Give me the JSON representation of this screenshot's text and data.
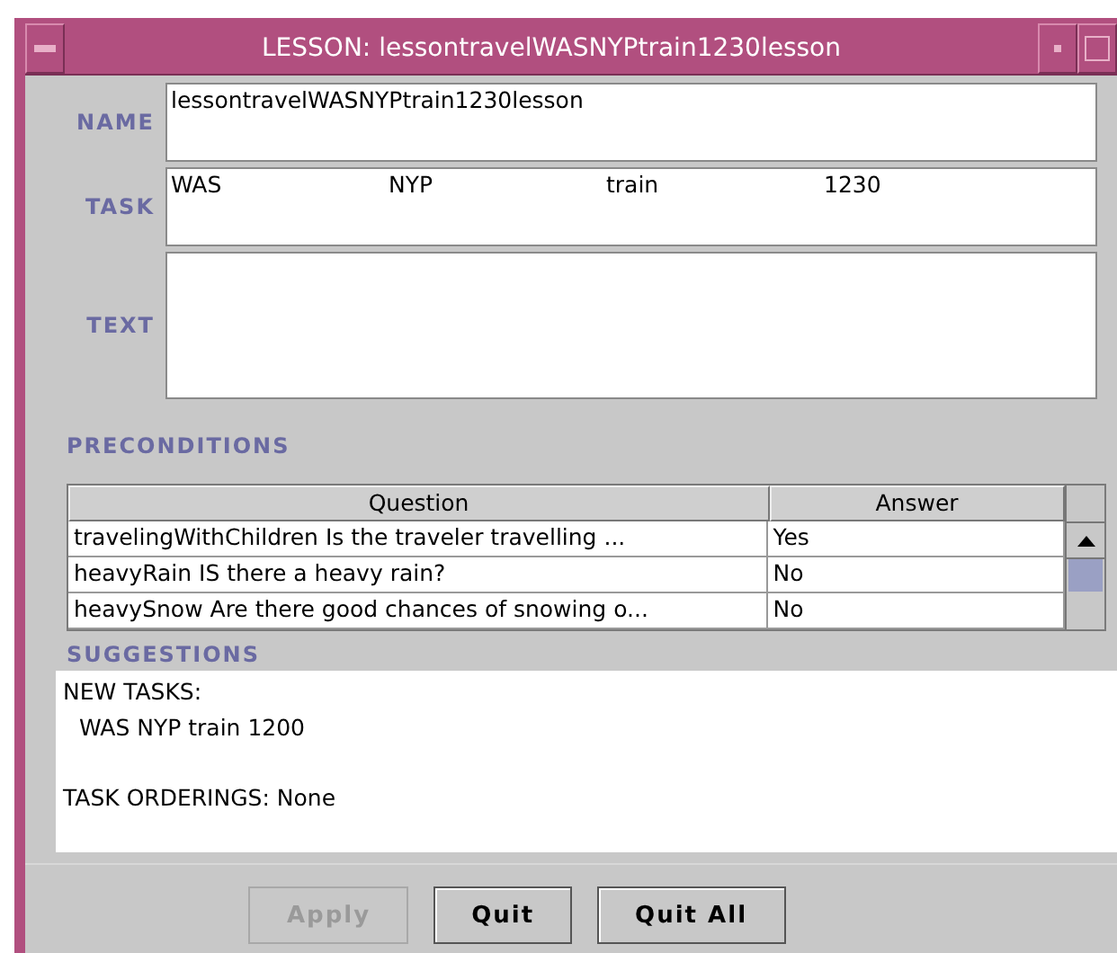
{
  "window": {
    "title": "LESSON: lessontravelWASNYPtrain1230lesson"
  },
  "fields": [
    {
      "label": "NAME",
      "kind": "single",
      "value": "lessontravelWASNYPtrain1230lesson"
    },
    {
      "label": "TASK",
      "kind": "tokens",
      "tokens": [
        "WAS",
        "NYP",
        "train",
        "1230"
      ]
    },
    {
      "label": "TEXT",
      "kind": "tall"
    }
  ],
  "preconditions": {
    "heading": "PRECONDITIONS",
    "columns": [
      "Question",
      "Answer"
    ],
    "rows": [
      {
        "question": "travelingWithChildren  Is the traveler travelling ...",
        "answer": "Yes"
      },
      {
        "question": "heavyRain  IS there a heavy rain?",
        "answer": "No"
      },
      {
        "question": "heavySnow  Are there good chances of snowing o...",
        "answer": "No"
      }
    ]
  },
  "suggestions": {
    "heading": "SUGGESTIONS",
    "blocks": [
      {
        "title": "NEW TASKS:",
        "items": [
          "WAS NYP train 1200"
        ]
      },
      {
        "title": "TASK ORDERINGS: None"
      }
    ]
  },
  "buttons": [
    {
      "label": "Apply",
      "disabled": true
    },
    {
      "label": "Quit",
      "disabled": false
    },
    {
      "label": "Quit All",
      "disabled": false
    }
  ]
}
